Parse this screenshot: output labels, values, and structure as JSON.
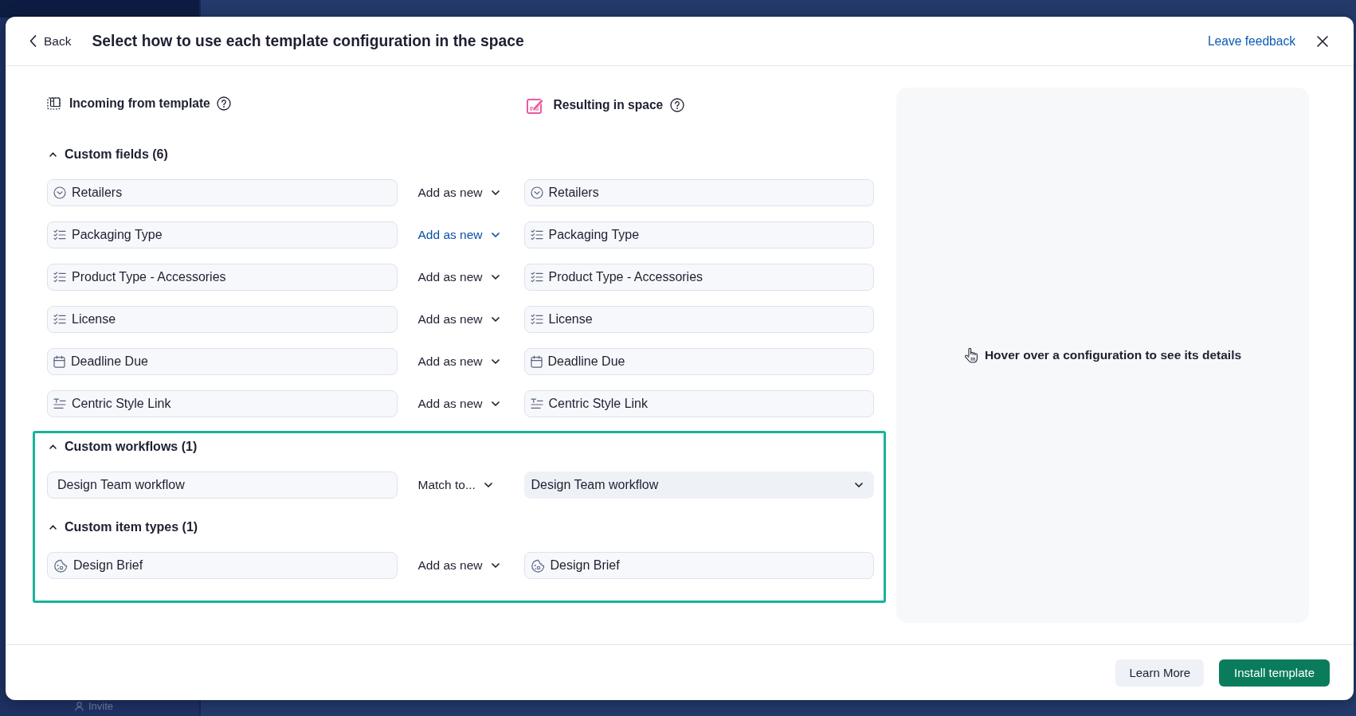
{
  "background": {
    "sidebar_label": "Invite"
  },
  "dialog": {
    "back_label": "Back",
    "title": "Select how to use each template configuration in the space",
    "feedback_link": "Leave feedback",
    "column_headings": [
      {
        "kind": "incoming",
        "label": "Incoming from template"
      },
      {
        "kind": "resulting",
        "label": "Resulting in space"
      }
    ],
    "sections": [
      {
        "title": "Custom fields (6)",
        "expanded": true,
        "highlighted": false,
        "rows": [
          {
            "kind": "select",
            "source": "Retailers",
            "action": "Add as new",
            "hovered": false,
            "target": "Retailers"
          },
          {
            "kind": "multiselect",
            "source": "Packaging Type",
            "action": "Add as new",
            "hovered": true,
            "target": "Packaging Type"
          },
          {
            "kind": "multiselect",
            "source": "Product Type - Accessories",
            "action": "Add as new",
            "hovered": false,
            "target": "Product Type - Accessories"
          },
          {
            "kind": "multiselect",
            "source": "License",
            "action": "Add as new",
            "hovered": false,
            "target": "License"
          },
          {
            "kind": "date",
            "source": "Deadline Due",
            "action": "Add as new",
            "hovered": false,
            "target": "Deadline Due"
          },
          {
            "kind": "text",
            "source": "Centric Style Link",
            "action": "Add as new",
            "hovered": false,
            "target": "Centric Style Link"
          }
        ]
      },
      {
        "title": "Custom workflows (1)",
        "expanded": true,
        "highlighted": true,
        "rows": [
          {
            "kind": "workflow",
            "source": "Design Team workflow",
            "action": "Match to...",
            "hovered": false,
            "target": "Design Team workflow"
          }
        ]
      },
      {
        "title": "Custom item types (1)",
        "expanded": true,
        "highlighted": true,
        "rows": [
          {
            "kind": "item_type",
            "source": "Design Brief",
            "action": "Add as new",
            "hovered": false,
            "target": "Design Brief"
          }
        ]
      }
    ],
    "details_hint": "Hover over a configuration to see its details",
    "buttons": [
      {
        "kind": "secondary",
        "label": "Learn More"
      },
      {
        "kind": "primary",
        "label": "Install template"
      }
    ]
  }
}
